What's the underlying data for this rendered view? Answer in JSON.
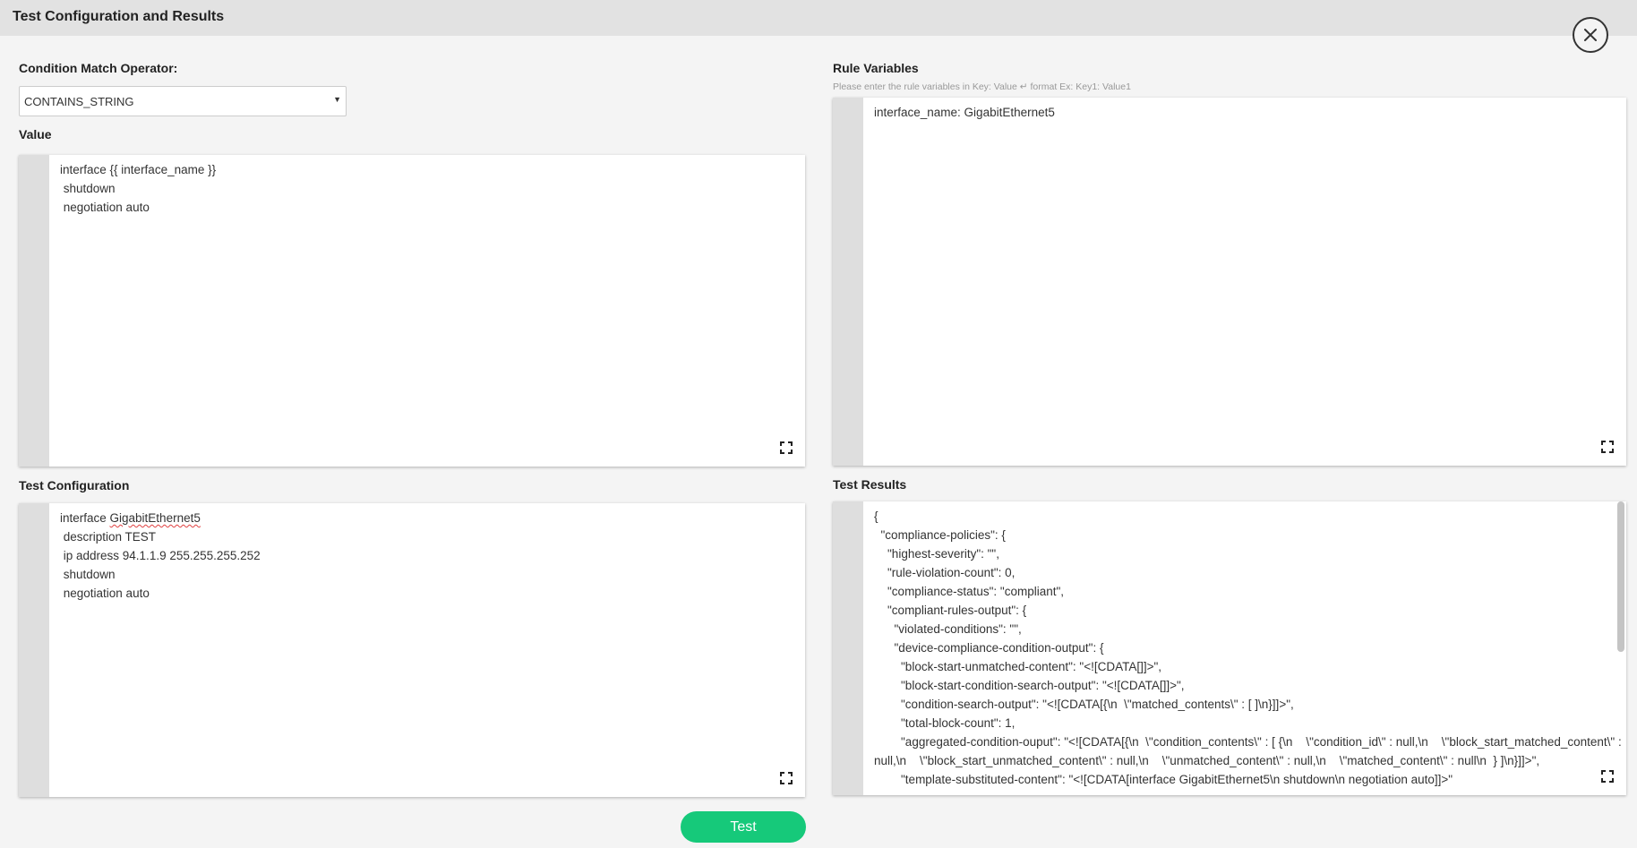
{
  "dialog": {
    "title": "Test Configuration and Results"
  },
  "operator": {
    "label": "Condition Match Operator:",
    "value": "CONTAINS_STRING"
  },
  "value_section": {
    "label": "Value",
    "lines": [
      "interface {{ interface_name }}",
      " shutdown",
      " negotiation auto"
    ]
  },
  "rule_variables": {
    "label": "Rule Variables",
    "hint": "Please enter the rule variables in Key: Value ↵ format Ex: Key1: Value1",
    "lines": [
      "interface_name: GigabitEthernet5"
    ]
  },
  "test_configuration": {
    "label": "Test Configuration",
    "line1_prefix": "interface ",
    "line1_word": "GigabitEthernet5",
    "lines": [
      " description TEST",
      " ip address 94.1.1.9 255.255.255.252",
      " shutdown",
      " negotiation auto"
    ]
  },
  "test_results": {
    "label": "Test Results",
    "text": "{\n  \"compliance-policies\": {\n    \"highest-severity\": \"\",\n    \"rule-violation-count\": 0,\n    \"compliance-status\": \"compliant\",\n    \"compliant-rules-output\": {\n      \"violated-conditions\": \"\",\n      \"device-compliance-condition-output\": {\n        \"block-start-unmatched-content\": \"<![CDATA[]]>\",\n        \"block-start-condition-search-output\": \"<![CDATA[]]>\",\n        \"condition-search-output\": \"<![CDATA[{\\n  \\\"matched_contents\\\" : [ ]\\n}]]>\",\n        \"total-block-count\": 1,\n        \"aggregated-condition-ouput\": \"<![CDATA[{\\n  \\\"condition_contents\\\" : [ {\\n    \\\"condition_id\\\" : null,\\n    \\\"block_start_matched_content\\\" : null,\\n    \\\"block_start_unmatched_content\\\" : null,\\n    \\\"unmatched_content\\\" : null,\\n    \\\"matched_content\\\" : null\\n  } ]\\n}]]>\",\n        \"template-substituted-content\": \"<![CDATA[interface GigabitEthernet5\\n shutdown\\n negotiation auto]]>\""
  },
  "actions": {
    "test_label": "Test"
  },
  "icons": {
    "close": "close-icon",
    "expand": "expand-icon"
  }
}
